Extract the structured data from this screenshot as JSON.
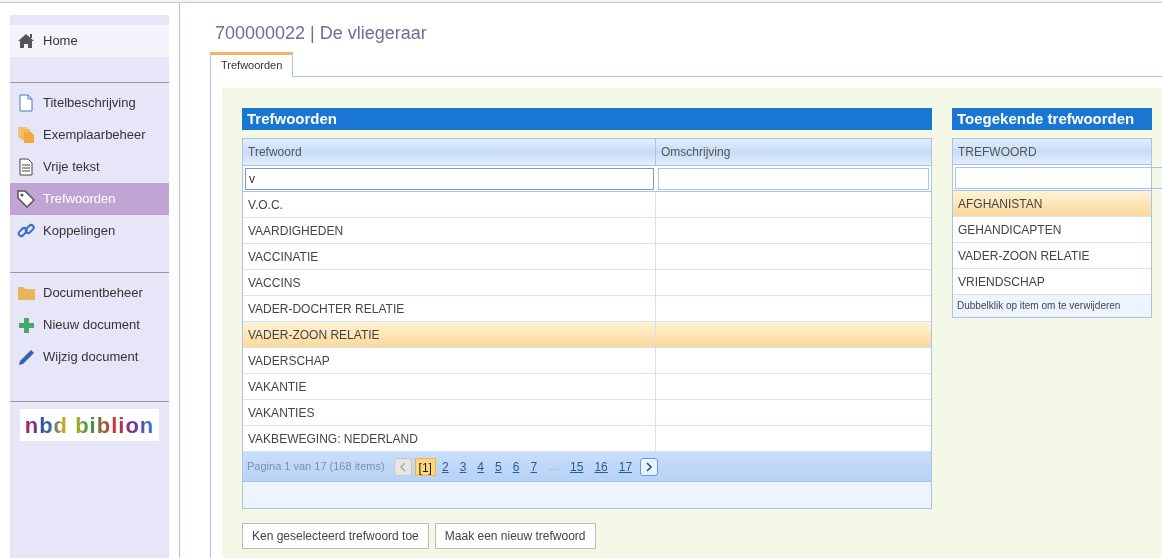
{
  "sidebar": {
    "groups": [
      [
        {
          "label": "Home",
          "selected": false
        }
      ],
      [
        {
          "label": "Titelbeschrijving",
          "selected": false
        },
        {
          "label": "Exemplaarbeheer",
          "selected": false
        },
        {
          "label": "Vrije tekst",
          "selected": false
        },
        {
          "label": "Trefwoorden",
          "selected": true
        },
        {
          "label": "Koppelingen",
          "selected": false
        }
      ],
      [
        {
          "label": "Documentbeheer",
          "selected": false
        },
        {
          "label": "Nieuw document",
          "selected": false
        },
        {
          "label": "Wijzig document",
          "selected": false
        }
      ]
    ],
    "logo": "nbd biblion"
  },
  "title": "700000022 | De vliegeraar",
  "tabs": [
    {
      "label": "Trefwoorden",
      "selected": true
    }
  ],
  "keywords": {
    "title": "Trefwoorden",
    "columns": [
      "Trefwoord",
      "Omschrijving"
    ],
    "filter_value": "v",
    "rows": [
      {
        "trefwoord": "V.O.C.",
        "selected": false
      },
      {
        "trefwoord": "VAARDIGHEDEN",
        "selected": false
      },
      {
        "trefwoord": "VACCINATIE",
        "selected": false
      },
      {
        "trefwoord": "VACCINS",
        "selected": false
      },
      {
        "trefwoord": "VADER-DOCHTER RELATIE",
        "selected": false
      },
      {
        "trefwoord": "VADER-ZOON RELATIE",
        "selected": true
      },
      {
        "trefwoord": "VADERSCHAP",
        "selected": false
      },
      {
        "trefwoord": "VAKANTIE",
        "selected": false
      },
      {
        "trefwoord": "VAKANTIES",
        "selected": false
      },
      {
        "trefwoord": "VAKBEWEGING: NEDERLAND",
        "selected": false
      }
    ],
    "pager": {
      "summary": "Pagina 1 van 17 (168 items)",
      "pages": [
        {
          "label": "[1]",
          "selected": true
        },
        {
          "label": "2",
          "selected": false
        },
        {
          "label": "3",
          "selected": false
        },
        {
          "label": "4",
          "selected": false
        },
        {
          "label": "5",
          "selected": false
        },
        {
          "label": "6",
          "selected": false
        },
        {
          "label": "7",
          "selected": false
        },
        {
          "label": "…",
          "kind": "ellipsis"
        },
        {
          "label": "15",
          "selected": false
        },
        {
          "label": "16",
          "selected": false
        },
        {
          "label": "17",
          "selected": false
        }
      ],
      "prev_disabled": true,
      "next_disabled": false
    }
  },
  "assigned": {
    "title": "Toegekende trefwoorden",
    "column": "TREFWOORD",
    "rows": [
      {
        "trefwoord": "AFGHANISTAN",
        "selected": true
      },
      {
        "trefwoord": "GEHANDICAPTEN",
        "selected": false
      },
      {
        "trefwoord": "VADER-ZOON RELATIE",
        "selected": false
      },
      {
        "trefwoord": "VRIENDSCHAP",
        "selected": false
      }
    ],
    "hint": "Dubbelklik op item om te verwijderen"
  },
  "buttons": [
    "Ken geselecteerd trefwoord toe",
    "Maak een nieuw trefwoord"
  ]
}
